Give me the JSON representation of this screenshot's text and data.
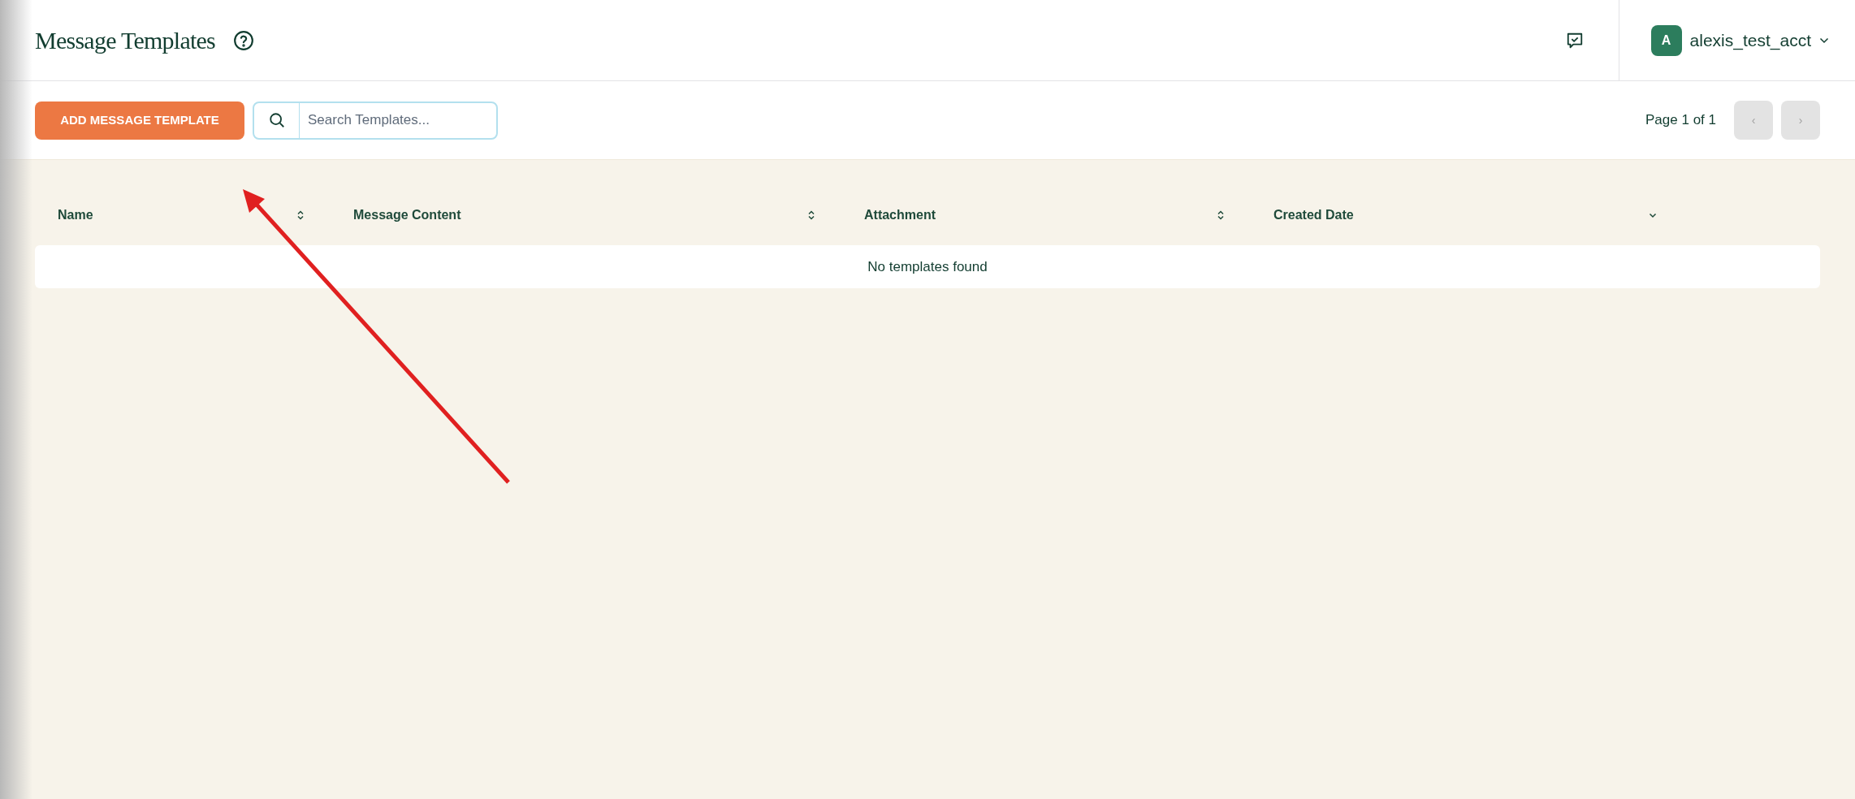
{
  "header": {
    "title": "Message Templates",
    "user": {
      "initial": "A",
      "name": "alexis_test_acct"
    }
  },
  "toolbar": {
    "add_button": "ADD MESSAGE TEMPLATE",
    "search": {
      "placeholder": "Search Templates..."
    },
    "pagination": {
      "label": "Page 1 of 1",
      "prev_disabled": true,
      "next_disabled": true,
      "prev": "‹",
      "next": "›"
    }
  },
  "table": {
    "columns": [
      {
        "label": "Name",
        "sorted": false
      },
      {
        "label": "Message Content",
        "sorted": false
      },
      {
        "label": "Attachment",
        "sorted": false
      },
      {
        "label": "Created Date",
        "sorted": true
      }
    ],
    "empty_message": "No templates found"
  }
}
